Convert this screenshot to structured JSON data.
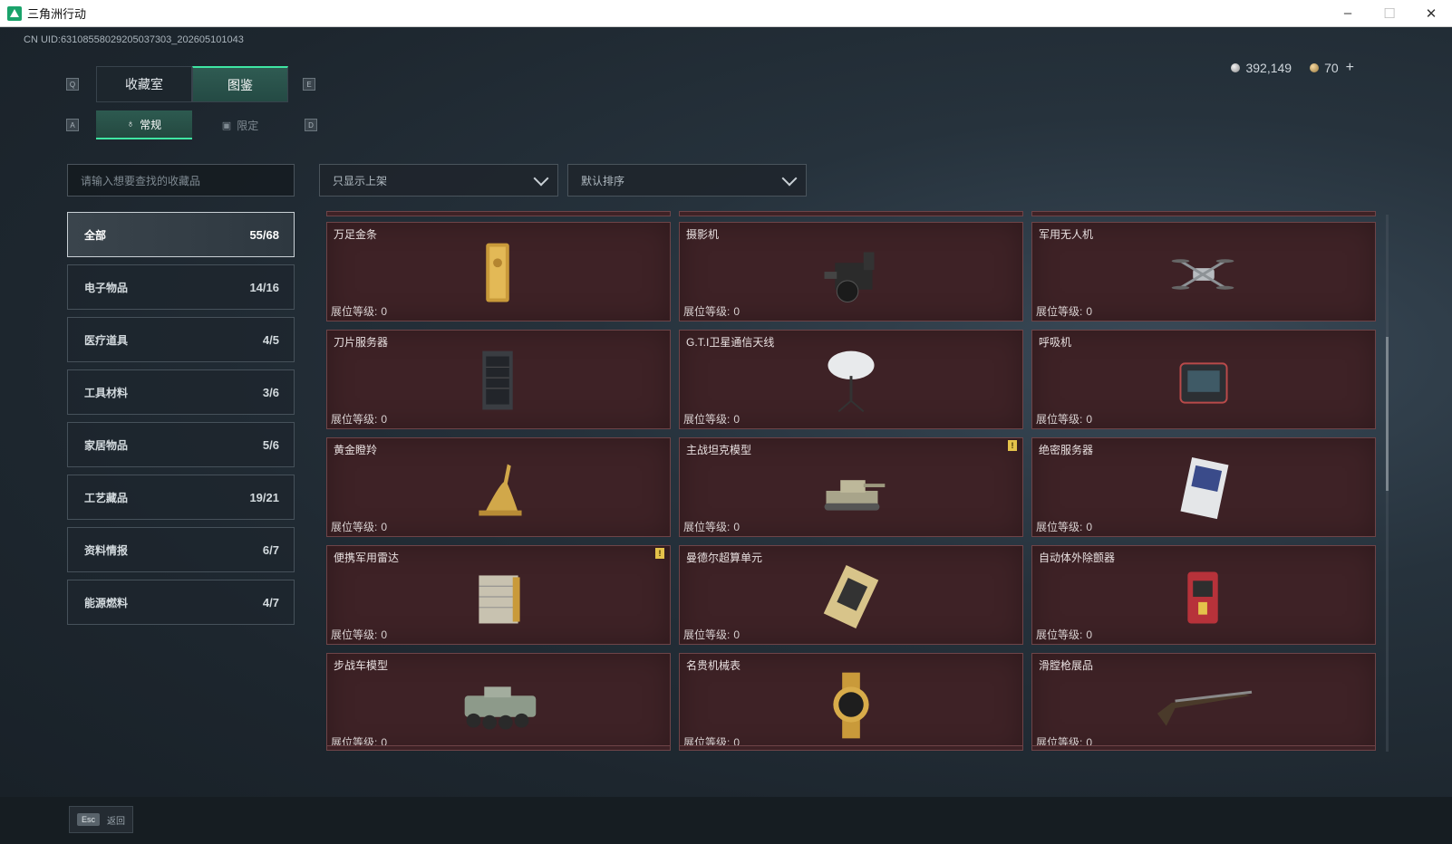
{
  "window": {
    "title": "三角洲行动",
    "minimize": "–",
    "maximize": "☐",
    "close": "✕"
  },
  "uid": "CN UID:6310855802920503730​3_202605101043",
  "currency": {
    "silver": "392,149",
    "gold": "70",
    "plus": "+"
  },
  "keys": {
    "tab_left": "Q",
    "tab_right": "E",
    "sub_left": "A",
    "sub_right": "D"
  },
  "tabs": [
    {
      "label": "收藏室"
    },
    {
      "label": "图鉴"
    }
  ],
  "subtabs": [
    {
      "label": "常规",
      "icon": "♁"
    },
    {
      "label": "限定",
      "icon": "▣"
    }
  ],
  "search": {
    "placeholder": "请输入想要查找的收藏品"
  },
  "filters": {
    "display": "只显示上架",
    "sort": "默认排序"
  },
  "categories": [
    {
      "name": "全部",
      "count": "55/68"
    },
    {
      "name": "电子物品",
      "count": "14/16"
    },
    {
      "name": "医疗道具",
      "count": "4/5"
    },
    {
      "name": "工具材料",
      "count": "3/6"
    },
    {
      "name": "家居物品",
      "count": "5/6"
    },
    {
      "name": "工艺藏品",
      "count": "19/21"
    },
    {
      "name": "资料情报",
      "count": "6/7"
    },
    {
      "name": "能源燃料",
      "count": "4/7"
    }
  ],
  "level_label": "展位等级:",
  "items": [
    {
      "name": "万足金条",
      "level": "0",
      "alert": false,
      "icon": "gold-bar-icon"
    },
    {
      "name": "摄影机",
      "level": "0",
      "alert": false,
      "icon": "camera-icon"
    },
    {
      "name": "军用无人机",
      "level": "0",
      "alert": false,
      "icon": "drone-icon"
    },
    {
      "name": "刀片服务器",
      "level": "0",
      "alert": false,
      "icon": "server-icon"
    },
    {
      "name": "G.T.I卫星通信天线",
      "level": "0",
      "alert": false,
      "icon": "satellite-dish-icon"
    },
    {
      "name": "呼吸机",
      "level": "0",
      "alert": false,
      "icon": "ventilator-icon"
    },
    {
      "name": "黄金瞪羚",
      "level": "0",
      "alert": false,
      "icon": "gazelle-statue-icon"
    },
    {
      "name": "主战坦克模型",
      "level": "0",
      "alert": true,
      "icon": "tank-icon"
    },
    {
      "name": "绝密服务器",
      "level": "0",
      "alert": false,
      "icon": "secret-server-icon"
    },
    {
      "name": "便携军用雷达",
      "level": "0",
      "alert": true,
      "icon": "radar-icon"
    },
    {
      "name": "曼德尔超算单元",
      "level": "0",
      "alert": false,
      "icon": "supercomputer-unit-icon"
    },
    {
      "name": "自动体外除颤器",
      "level": "0",
      "alert": false,
      "icon": "defibrillator-icon"
    },
    {
      "name": "步战车模型",
      "level": "0",
      "alert": false,
      "icon": "ifv-icon"
    },
    {
      "name": "名贵机械表",
      "level": "0",
      "alert": false,
      "icon": "watch-icon"
    },
    {
      "name": "滑膛枪展品",
      "level": "0",
      "alert": false,
      "icon": "musket-icon"
    }
  ],
  "alert_mark": "!",
  "footer": {
    "esc_key": "Esc",
    "back_label": "返回"
  }
}
